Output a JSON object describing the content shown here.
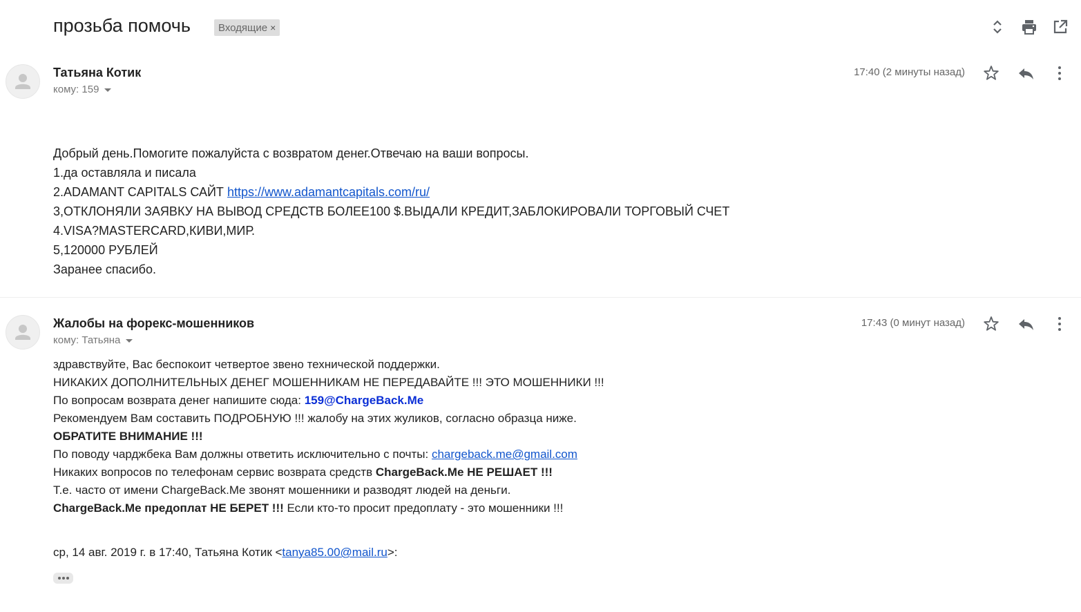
{
  "thread": {
    "subject": "прозьба помочь",
    "label": "Входящие",
    "label_remove": "×"
  },
  "toolbar": {
    "icons": [
      "expand-collapse-icon",
      "print-icon",
      "open-new-window-icon"
    ]
  },
  "messages": [
    {
      "sender": "Татьяна Котик",
      "to": "кому: 159",
      "time": "17:40 (2 минуты назад)",
      "body": {
        "l1": "Добрый день.Помогите пожалуйста с возвратом денег.Отвечаю на ваши вопросы.",
        "l2": "1.да оставляла и писала",
        "l3_prefix": "2.ADAMANT CAPITALS САЙТ ",
        "l3_link": "https://www.adamantcapitals.com/ru/",
        "l4": "3,ОТКЛОНЯЛИ ЗАЯВКУ НА ВЫВОД СРЕДСТВ БОЛЕЕ100 $.ВЫДАЛИ КРЕДИТ,ЗАБЛОКИРОВАЛИ ТОРГОВЫЙ СЧЕТ",
        "l5": "4.VISA?MASTERCARD,КИВИ,МИР.",
        "l6": "5,120000 РУБЛЕЙ",
        "l7": "Заранее спасибо."
      }
    },
    {
      "sender": "Жалобы на форекс-мошенников",
      "to": "кому: Татьяна",
      "time": "17:43 (0 минут назад)",
      "body": {
        "l1": "здравствуйте, Вас беспокоит четвертое звено технической поддержки.",
        "l2": "НИКАКИХ ДОПОЛНИТЕЛЬНЫХ ДЕНЕГ МОШЕННИКАМ НЕ ПЕРЕДАВАЙТЕ !!! ЭТО МОШЕННИКИ !!!",
        "l3_prefix": "По вопросам возврата денег напишите сюда: ",
        "l3_email": "159@ChargeBack.Me",
        "l4": "Рекомендуем Вам составить ПОДРОБНУЮ !!! жалобу на этих жуликов, согласно образца ниже.",
        "l5": "ОБРАТИТЕ ВНИМАНИЕ !!!",
        "l6_prefix": "По поводу чарджбека Вам должны ответить исключительно с почты: ",
        "l6_link": "chargeback.me@gmail.com",
        "l7_prefix": "Никаких вопросов по телефонам сервис возврата средств ",
        "l7_bold": "ChargeBack.Me НЕ РЕШАЕТ !!!",
        "l8": "Т.е. часто от имени ChargeBack.Me звонят мошенники и разводят людей на деньги.",
        "l9_bold": "ChargeBack.Me предоплат НЕ БЕРЕТ !!!",
        "l9_suffix": " Если кто-то просит предоплату - это мошенники !!!"
      },
      "quote": {
        "prefix": "ср, 14 авг. 2019 г. в 17:40, Татьяна Котик <",
        "email": "tanya85.00@mail.ru",
        "suffix": ">:"
      }
    }
  ]
}
